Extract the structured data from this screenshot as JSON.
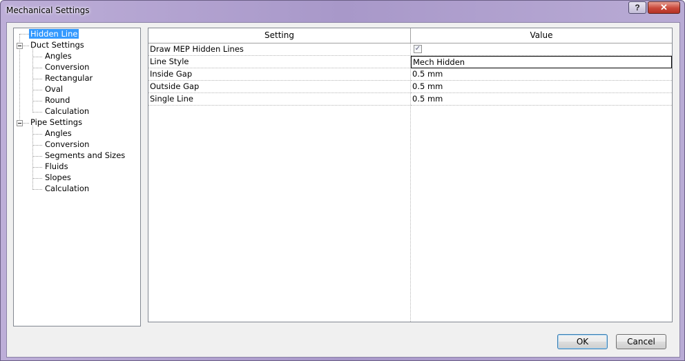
{
  "window": {
    "title": "Mechanical Settings",
    "help_label": "?",
    "close_label": "✕"
  },
  "tree": {
    "items": [
      {
        "label": "Hidden Line",
        "level": 0,
        "selected": true,
        "expander": false
      },
      {
        "label": "Duct Settings",
        "level": 0,
        "selected": false,
        "expander": true
      },
      {
        "label": "Angles",
        "level": 1
      },
      {
        "label": "Conversion",
        "level": 1
      },
      {
        "label": "Rectangular",
        "level": 1
      },
      {
        "label": "Oval",
        "level": 1
      },
      {
        "label": "Round",
        "level": 1
      },
      {
        "label": "Calculation",
        "level": 1
      },
      {
        "label": "Pipe Settings",
        "level": 0,
        "selected": false,
        "expander": true
      },
      {
        "label": "Angles",
        "level": 1
      },
      {
        "label": "Conversion",
        "level": 1
      },
      {
        "label": "Segments and Sizes",
        "level": 1
      },
      {
        "label": "Fluids",
        "level": 1
      },
      {
        "label": "Slopes",
        "level": 1
      },
      {
        "label": "Calculation",
        "level": 1
      }
    ]
  },
  "grid": {
    "headers": {
      "setting": "Setting",
      "value": "Value"
    },
    "rows": [
      {
        "setting": "Draw MEP Hidden Lines",
        "value": "",
        "checkbox": true,
        "checked_glyph": "✓"
      },
      {
        "setting": "Line Style",
        "value": "Mech Hidden",
        "active": true
      },
      {
        "setting": "Inside Gap",
        "value": "0.5 mm"
      },
      {
        "setting": "Outside Gap",
        "value": "0.5 mm"
      },
      {
        "setting": "Single Line",
        "value": "0.5 mm"
      }
    ]
  },
  "buttons": {
    "ok": "OK",
    "cancel": "Cancel"
  }
}
